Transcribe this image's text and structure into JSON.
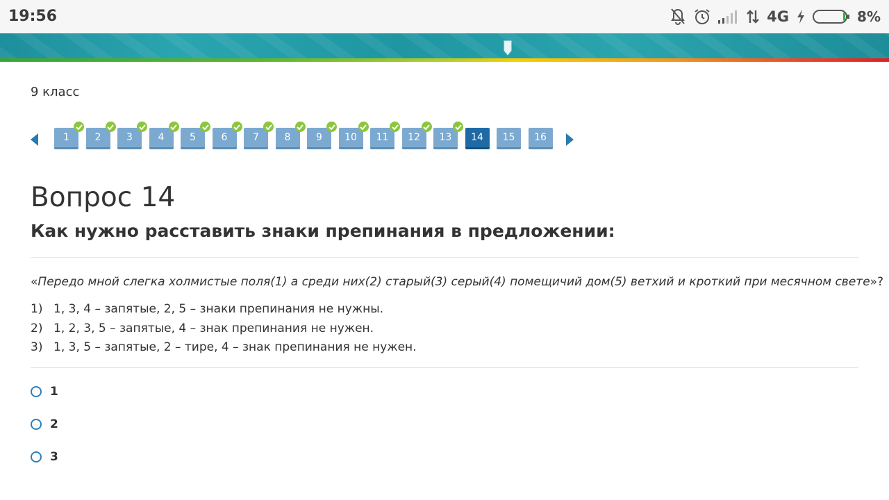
{
  "status_bar": {
    "time": "19:56",
    "network": "4G",
    "battery": "8%"
  },
  "page": {
    "grade": "9 класс"
  },
  "question_nav": {
    "buttons": [
      {
        "label": "1",
        "answered": true
      },
      {
        "label": "2",
        "answered": true
      },
      {
        "label": "3",
        "answered": true
      },
      {
        "label": "4",
        "answered": true
      },
      {
        "label": "5",
        "answered": true
      },
      {
        "label": "6",
        "answered": true
      },
      {
        "label": "7",
        "answered": true
      },
      {
        "label": "8",
        "answered": true
      },
      {
        "label": "9",
        "answered": true
      },
      {
        "label": "10",
        "answered": true
      },
      {
        "label": "11",
        "answered": true
      },
      {
        "label": "12",
        "answered": true
      },
      {
        "label": "13",
        "answered": true
      },
      {
        "label": "14",
        "answered": false,
        "current": true
      },
      {
        "label": "15",
        "answered": false
      },
      {
        "label": "16",
        "answered": false
      }
    ]
  },
  "question": {
    "title": "Вопрос 14",
    "prompt": "Как нужно расставить знаки препинания в предложении:",
    "sentence_open": "«",
    "sentence": "Передо мной слегка холмистые поля(1) а среди них(2) старый(3) серый(4) помещичий дом(5) ветхий и кроткий при месячном свете",
    "sentence_close": "»?",
    "options": [
      {
        "num": "1)",
        "text": "1, 3, 4 – запятые, 2, 5 – знаки препинания не нужны."
      },
      {
        "num": "2)",
        "text": "1, 2, 3, 5 – запятые, 4 – знак препинания не нужен."
      },
      {
        "num": "3)",
        "text": "1, 3, 5 – запятые, 2 – тире, 4 – знак препинания не нужен."
      }
    ],
    "answers": [
      "1",
      "2",
      "3"
    ]
  },
  "colors": {
    "nav_button": "#7ca9cf",
    "nav_button_current": "#1f6aa5",
    "check_badge": "#8cc63f",
    "radio_border": "#2d7fb8",
    "header_teal": "#2aa5b0"
  }
}
